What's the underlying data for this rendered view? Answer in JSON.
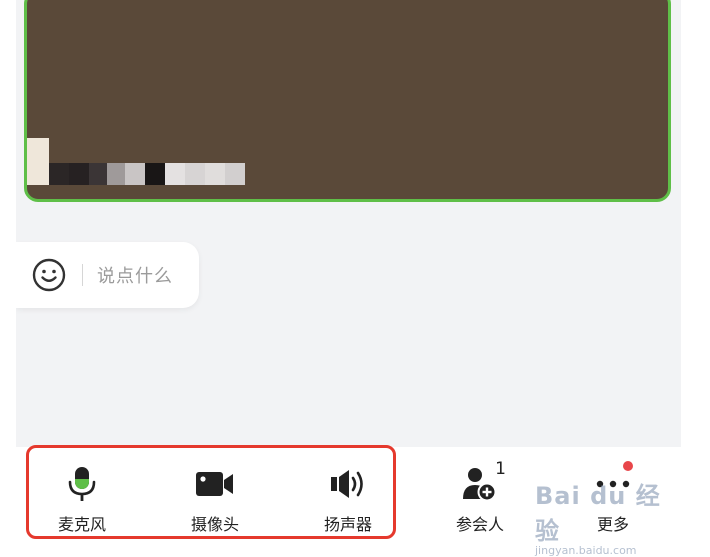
{
  "chat": {
    "placeholder": "说点什么"
  },
  "toolbar": {
    "items": [
      {
        "label": "麦克风",
        "icon": "microphone-icon"
      },
      {
        "label": "摄像头",
        "icon": "camera-icon"
      },
      {
        "label": "扬声器",
        "icon": "speaker-icon"
      },
      {
        "label": "参会人",
        "icon": "participants-icon",
        "count": "1"
      },
      {
        "label": "更多",
        "icon": "more-icon"
      }
    ]
  },
  "watermark": {
    "line1": "Bai du 经验",
    "line2": "jingyan.baidu.com"
  },
  "colors": {
    "video_border": "#5fbf48",
    "mic_active": "#5fbf48",
    "highlight": "#e5392d",
    "notification_dot": "#e8464a"
  }
}
